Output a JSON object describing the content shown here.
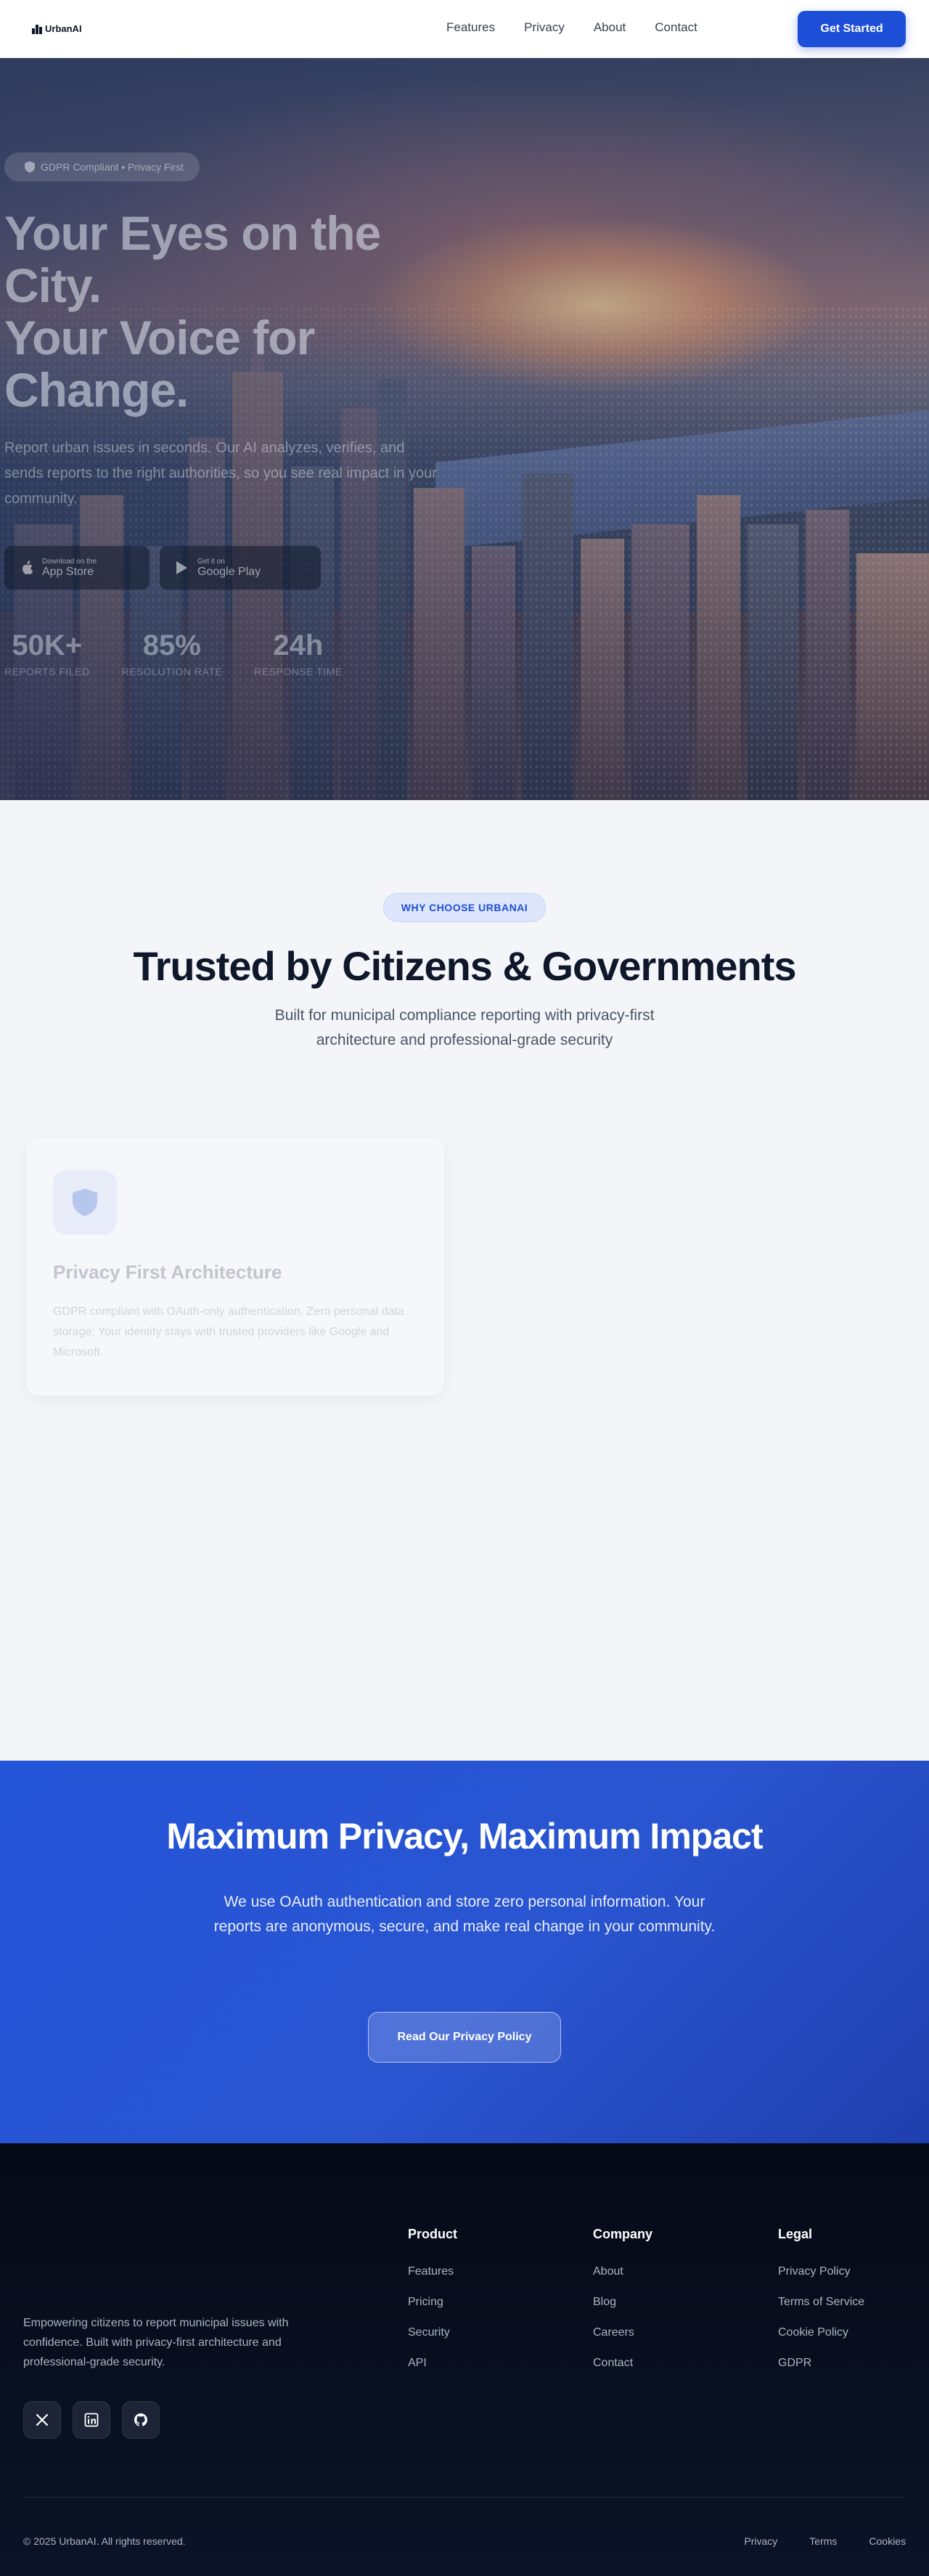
{
  "nav": {
    "brand": "UrbanAI",
    "links": [
      "Features",
      "Privacy",
      "About",
      "Contact"
    ],
    "cta": "Get Started"
  },
  "hero": {
    "badge": "GDPR Compliant • Privacy First",
    "title_line1": "Your Eyes on the City.",
    "title_line2": "Your Voice for Change.",
    "subtitle": "Report urban issues in seconds. Our AI analyzes, verifies, and sends reports to the right authorities, so you see real impact in your community.",
    "app_store": {
      "small": "Download on the",
      "big": "App Store"
    },
    "google_play": {
      "small": "Get it on",
      "big": "Google Play"
    },
    "stats": [
      {
        "value": "50K+",
        "label": "REPORTS FILED"
      },
      {
        "value": "85%",
        "label": "RESOLUTION RATE"
      },
      {
        "value": "24h",
        "label": "RESPONSE TIME"
      }
    ]
  },
  "why": {
    "pill": "WHY CHOOSE URBANAI",
    "title": "Trusted by Citizens & Governments",
    "subtitle": "Built for municipal compliance reporting with privacy-first architecture and professional-grade security",
    "card": {
      "icon": "shield-icon",
      "title": "Privacy First Architecture",
      "text": "GDPR compliant with OAuth-only authentication. Zero personal data storage. Your identity stays with trusted providers like Google and Microsoft."
    }
  },
  "cta": {
    "title": "Maximum Privacy, Maximum Impact",
    "text": "We use OAuth authentication and store zero personal information. Your reports are anonymous, secure, and make real change in your community.",
    "button": "Read Our Privacy Policy"
  },
  "footer": {
    "description": "Empowering citizens to report municipal issues with confidence. Built with privacy-first architecture and professional-grade security.",
    "socials": [
      "x-icon",
      "linkedin-icon",
      "github-icon"
    ],
    "columns": {
      "product": {
        "heading": "Product",
        "links": [
          "Features",
          "Pricing",
          "Security",
          "API"
        ]
      },
      "company": {
        "heading": "Company",
        "links": [
          "About",
          "Blog",
          "Careers",
          "Contact"
        ]
      },
      "legal": {
        "heading": "Legal",
        "links": [
          "Privacy Policy",
          "Terms of Service",
          "Cookie Policy",
          "GDPR"
        ]
      }
    },
    "copyright": "© 2025 UrbanAI. All rights reserved.",
    "bottom_links": [
      "Privacy",
      "Terms",
      "Cookies"
    ]
  }
}
